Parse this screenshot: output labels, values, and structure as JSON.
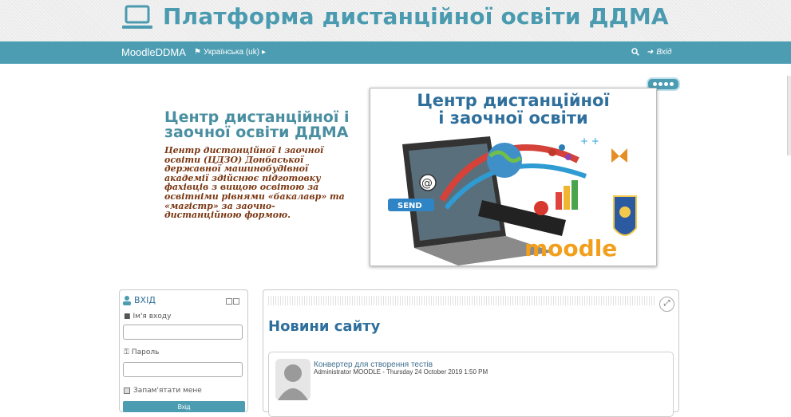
{
  "header": {
    "title": "Платформа дистанційної освіти ДДМА"
  },
  "navbar": {
    "brand": "MoodleDDMA",
    "language": "Українська (uk)",
    "login_label": "Вхід"
  },
  "promo": {
    "title": "Центр дистанційної і заочної освіти ДДМА",
    "text": "Центр дистанційної і заочної освіти (ЦДЗО) Донбаської державної машинобудівної академії здійснює підготовку фахівців з вищою освітою за освітніми рівнями «бакалавр» та «магістр» за заочно-дистанційною формою."
  },
  "banner": {
    "title_line1": "Центр дистанційної",
    "title_line2": "і заочної освіти",
    "send_label": "SEND",
    "moodle_label": "moodle"
  },
  "login_block": {
    "title": "ВХІД",
    "username_label": "Ім'я входу",
    "password_label": "Пароль",
    "remember_label": "Запам'ятати мене",
    "submit_label": "Вхід"
  },
  "news": {
    "title": "Новини сайту",
    "post": {
      "subject": "Конвертер для створення тестів",
      "meta": "Administrator MOODLE - Thursday 24 October 2019 1:50 PM"
    }
  },
  "colors": {
    "accent": "#4c9db2",
    "title": "#4b9bb0",
    "promo_text": "#7a3712",
    "link": "#2f6f9c"
  },
  "icons": [
    "laptop-icon",
    "flag-icon",
    "search-icon",
    "login-icon",
    "user-icon",
    "key-icon",
    "expand-icon",
    "avatar"
  ]
}
